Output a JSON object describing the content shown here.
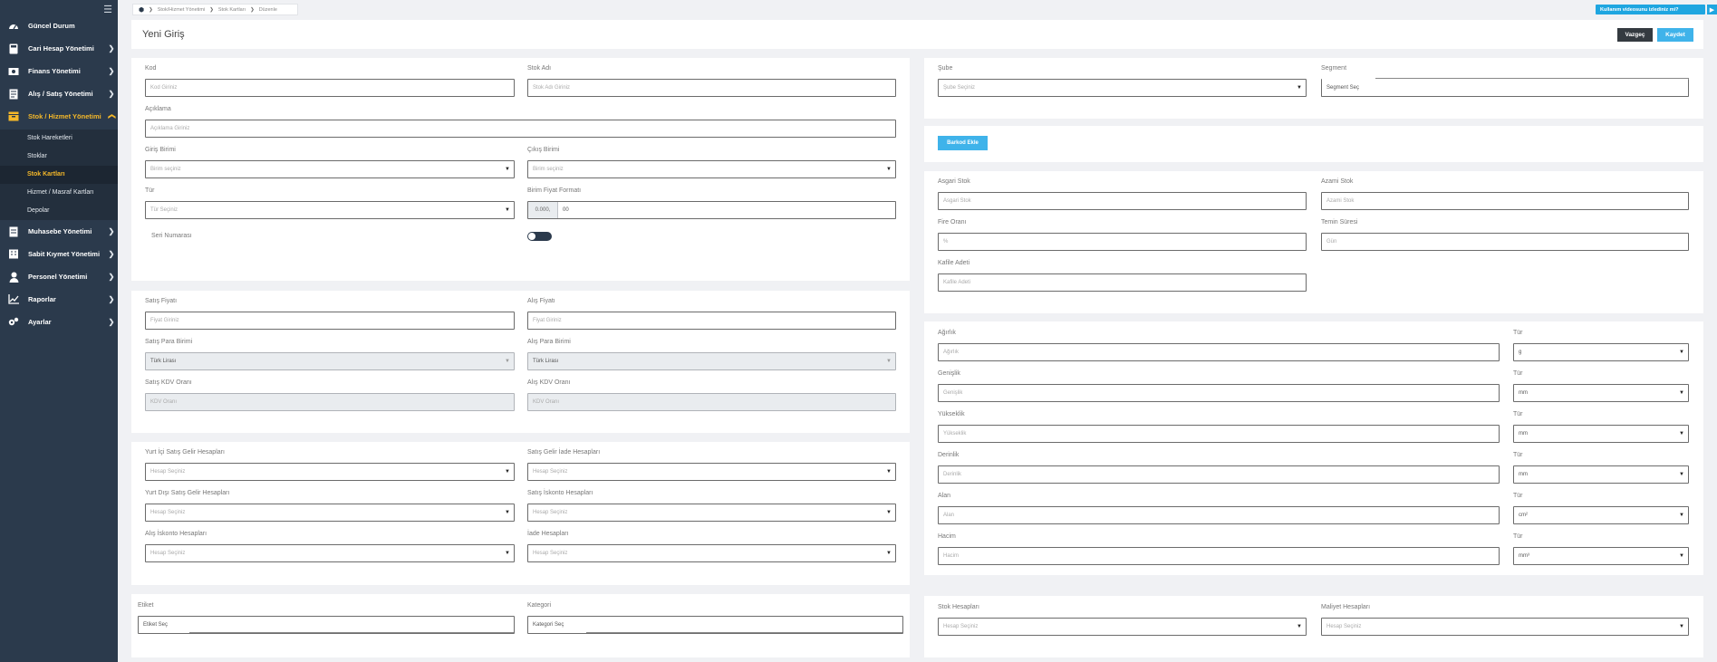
{
  "sidebar": {
    "menu": [
      {
        "label": "Güncel Durum"
      },
      {
        "label": "Cari Hesap Yönetimi"
      },
      {
        "label": "Finans Yönetimi"
      },
      {
        "label": "Alış / Satış Yönetimi"
      },
      {
        "label": "Stok / Hizmet Yönetimi"
      },
      {
        "label": "Muhasebe Yönetimi"
      },
      {
        "label": "Sabit Kıymet Yönetimi"
      },
      {
        "label": "Personel Yönetimi"
      },
      {
        "label": "Raporlar"
      },
      {
        "label": "Ayarlar"
      }
    ],
    "submenu": [
      {
        "label": "Stok Hareketleri"
      },
      {
        "label": "Stoklar"
      },
      {
        "label": "Stok Kartları"
      },
      {
        "label": "Hizmet / Masraf Kartları"
      },
      {
        "label": "Depolar"
      }
    ],
    "active_color": "#f5b829"
  },
  "breadcrumb": {
    "items": [
      "Stok/Hizmet Yönetimi",
      "Stok Kartları",
      "Düzenle"
    ]
  },
  "video_button": "Kullanım videosunu izlediniz mi?",
  "header": {
    "title": "Yeni Giriş",
    "cancel": "Vazgeç",
    "save": "Kaydet",
    "accent": "#3fb3ea"
  },
  "general": {
    "kod": {
      "label": "Kod",
      "placeholder": "Kod Giriniz"
    },
    "stok_adi": {
      "label": "Stok Adı",
      "placeholder": "Stok Adı Giriniz"
    },
    "aciklama": {
      "label": "Açıklama",
      "placeholder": "Açıklama Giriniz"
    },
    "giris_birimi": {
      "label": "Giriş Birimi",
      "placeholder": "Birim seçiniz"
    },
    "cikis_birimi": {
      "label": "Çıkış Birimi",
      "placeholder": "Birim seçiniz"
    },
    "tur": {
      "label": "Tür",
      "placeholder": "Tür Seçiniz"
    },
    "birim_fiyat_formati": {
      "label": "Birim Fiyat Formatı",
      "prefix": "0.000,",
      "value": "00"
    },
    "seri_numarasi": {
      "label": "Seri Numarası"
    }
  },
  "pricing": {
    "satis_fiyati": {
      "label": "Satış Fiyatı",
      "placeholder": "Fiyat Giriniz"
    },
    "alis_fiyati": {
      "label": "Alış Fiyatı",
      "placeholder": "Fiyat Giriniz"
    },
    "satis_para_birimi": {
      "label": "Satış Para Birimi",
      "value": "Türk Lirası"
    },
    "alis_para_birimi": {
      "label": "Alış Para Birimi",
      "value": "Türk Lirası"
    },
    "satis_kdv": {
      "label": "Satış KDV Oranı",
      "placeholder": "KDV Oranı"
    },
    "alis_kdv": {
      "label": "Alış KDV Oranı",
      "placeholder": "KDV Oranı"
    }
  },
  "accounts": {
    "yurt_ici": {
      "label": "Yurt İçi Satış Gelir Hesapları",
      "placeholder": "Hesap Seçiniz"
    },
    "satis_iade": {
      "label": "Satış Gelir İade Hesapları",
      "placeholder": "Hesap Seçiniz"
    },
    "yurt_disi": {
      "label": "Yurt Dışı Satış Gelir Hesapları",
      "placeholder": "Hesap Seçiniz"
    },
    "satis_iskonto": {
      "label": "Satış İskonto Hesapları",
      "placeholder": "Hesap Seçiniz"
    },
    "alis_iskonto": {
      "label": "Alış İskonto Hesapları",
      "placeholder": "Hesap Seçiniz"
    },
    "iade": {
      "label": "İade Hesapları",
      "placeholder": "Hesap Seçiniz"
    }
  },
  "tags": {
    "etiket": {
      "label": "Etiket",
      "placeholder": "Etiket Seç"
    },
    "kategori": {
      "label": "Kategori",
      "placeholder": "Kategori Seç"
    }
  },
  "branch": {
    "sube": {
      "label": "Şube",
      "placeholder": "Şube Seçiniz"
    },
    "segment": {
      "label": "Segment",
      "placeholder": "Segment Seç"
    }
  },
  "barcode": {
    "button": "Barkod Ekle"
  },
  "stock_limits": {
    "asgari": {
      "label": "Asgari Stok",
      "placeholder": "Asgari Stok"
    },
    "azami": {
      "label": "Azami Stok",
      "placeholder": "Azami Stok"
    },
    "fire": {
      "label": "Fire Oranı",
      "placeholder": "%"
    },
    "temin": {
      "label": "Temin Süresi",
      "placeholder": "Gün"
    },
    "kafile": {
      "label": "Kafile Adeti",
      "placeholder": "Kafile Adeti"
    }
  },
  "dimensions": [
    {
      "label": "Ağırlık",
      "placeholder": "Ağırlık",
      "unit_label": "Tür",
      "unit": "g"
    },
    {
      "label": "Genişlik",
      "placeholder": "Genişlik",
      "unit_label": "Tür",
      "unit": "mm"
    },
    {
      "label": "Yükseklik",
      "placeholder": "Yükseklik",
      "unit_label": "Tür",
      "unit": "mm"
    },
    {
      "label": "Derinlik",
      "placeholder": "Derinlik",
      "unit_label": "Tür",
      "unit": "mm"
    },
    {
      "label": "Alan",
      "placeholder": "Alan",
      "unit_label": "Tür",
      "unit": "cm²"
    },
    {
      "label": "Hacim",
      "placeholder": "Hacim",
      "unit_label": "Tür",
      "unit": "mm³"
    }
  ],
  "stock_accounts": {
    "stok": {
      "label": "Stok Hesapları",
      "placeholder": "Hesap Seçiniz"
    },
    "maliyet": {
      "label": "Maliyet Hesapları",
      "placeholder": "Hesap Seçiniz"
    }
  }
}
